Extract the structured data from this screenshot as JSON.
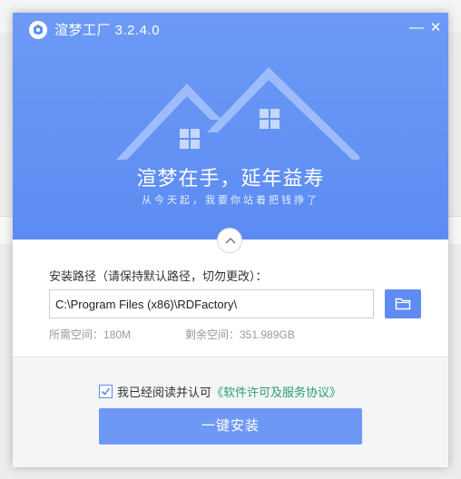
{
  "app": {
    "title": "渲梦工厂 3.2.4.0",
    "minimize_glyph": "—",
    "close_glyph": "✕"
  },
  "banner": {
    "slogan": "渲梦在手，延年益寿",
    "subslogan": "从今天起，我要你站着把钱挣了"
  },
  "install_path": {
    "label": "安装路径（请保持默认路径，切勿更改）：",
    "value": "C:\\Program Files (x86)\\RDFactory\\",
    "browse_icon": "folder-icon"
  },
  "space": {
    "required": "所需空间：180M",
    "free": "剩余空间：351.989GB"
  },
  "agreement": {
    "checked": true,
    "text": "我已经阅读并认可",
    "link": "《软件许可及服务协议》"
  },
  "actions": {
    "install_label": "一键安装"
  },
  "colors": {
    "accent": "#5e8cf2",
    "header": "#6d9af6",
    "link": "#2aa06a"
  }
}
